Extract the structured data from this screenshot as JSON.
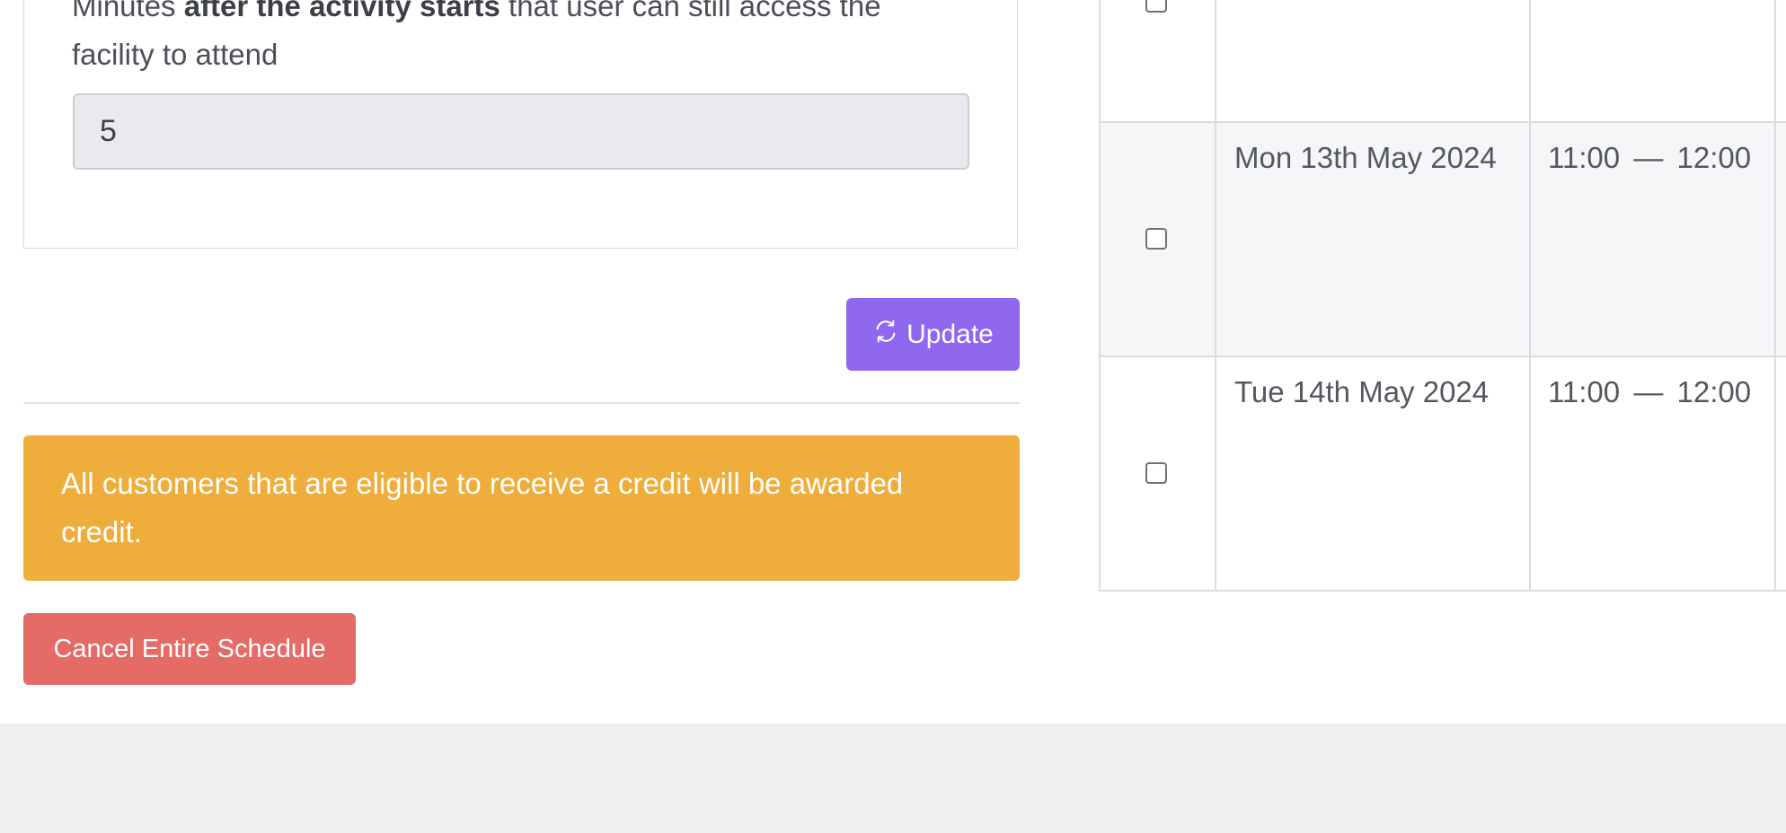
{
  "settings": {
    "desc_prefix": "Minutes ",
    "desc_bold": "after the activity starts",
    "desc_suffix": " that user can still access the facility to attend",
    "minutes_value": "5"
  },
  "actions": {
    "update_label": "Update",
    "alert_text": "All customers that are eligible to receive a credit will be awarded credit.",
    "cancel_label": "Cancel Entire Schedule"
  },
  "schedule": {
    "rows": [
      {
        "date": "",
        "start": "",
        "sep": "",
        "end": ""
      },
      {
        "date": "Mon 13th May 2024",
        "start": "11:00",
        "sep": "—",
        "end": "12:00"
      },
      {
        "date": "Tue 14th May 2024",
        "start": "11:00",
        "sep": "—",
        "end": "12:00"
      }
    ]
  },
  "colors": {
    "update_button": "#8f68ef",
    "alert": "#efad3b",
    "cancel_button": "#e56b66"
  },
  "icons": {
    "update": "refresh-icon"
  }
}
